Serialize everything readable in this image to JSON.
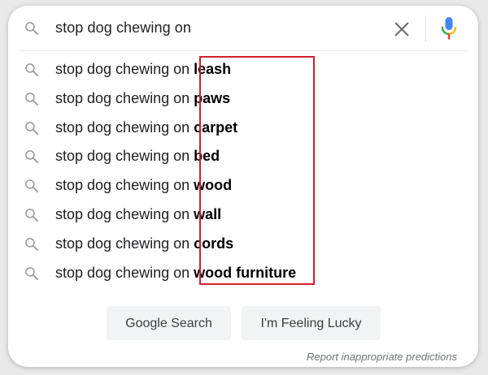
{
  "search": {
    "query": "stop dog chewing on",
    "icon": "search-icon",
    "clear_icon": "close-icon",
    "voice_icon": "mic-icon"
  },
  "suggestions": [
    {
      "prefix": "stop dog chewing on ",
      "suffix": "leash"
    },
    {
      "prefix": "stop dog chewing on ",
      "suffix": "paws"
    },
    {
      "prefix": "stop dog chewing on ",
      "suffix": "carpet"
    },
    {
      "prefix": "stop dog chewing on ",
      "suffix": "bed"
    },
    {
      "prefix": "stop dog chewing on ",
      "suffix": "wood"
    },
    {
      "prefix": "stop dog chewing on ",
      "suffix": "wall"
    },
    {
      "prefix": "stop dog chewing on ",
      "suffix": "cords"
    },
    {
      "prefix": "stop dog chewing on ",
      "suffix": "wood furniture"
    }
  ],
  "buttons": {
    "google_search": "Google Search",
    "feeling_lucky": "I'm Feeling Lucky"
  },
  "footer": {
    "report": "Report inappropriate predictions"
  },
  "colors": {
    "highlight_box": "#d0202a",
    "mic_blue": "#4285f4",
    "mic_red": "#ea4335",
    "mic_yellow": "#fbbc05",
    "mic_green": "#34a853"
  }
}
